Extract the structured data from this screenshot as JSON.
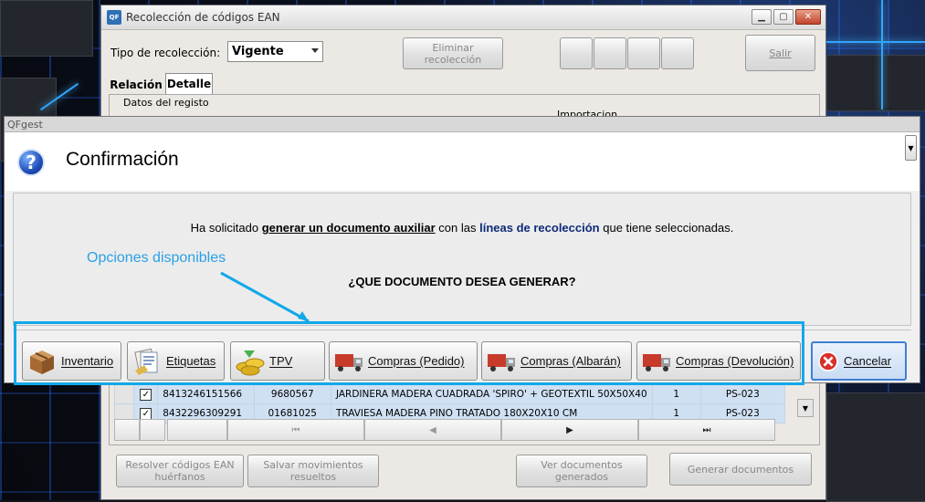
{
  "main_window": {
    "title": "Recolección de códigos EAN",
    "tipo_label": "Tipo de recolección:",
    "tipo_value": "Vigente",
    "eliminar_label": "Eliminar recolección",
    "salir_label": "Salir",
    "tabs": [
      {
        "label": "Relación"
      },
      {
        "label": "Detalle"
      }
    ],
    "datos_label": "Datos del registo",
    "importacion_label": "Importacion",
    "rows": [
      {
        "ean": "8413246151566",
        "ref": "9680567",
        "desc": "JARDINERA MADERA CUADRADA 'SPIRO' + GEOTEXTIL 50X50X40",
        "qty": "1",
        "code": "PS-023"
      },
      {
        "ean": "8432296309291",
        "ref": "01681025",
        "desc": "TRAVIESA MADERA PINO TRATADO 180X20X10 CM",
        "qty": "1",
        "code": "PS-023"
      }
    ],
    "resolver_label": "Resolver códigos EAN huérfanos",
    "salvar_label": "Salvar movimientos resueltos",
    "ver_label": "Ver documentos generados",
    "generar_label": "Generar documentos"
  },
  "dialog": {
    "window_title": "QFgest",
    "header": "Confirmación",
    "msg_part1": "Ha solicitado ",
    "msg_bold1": "generar un documento auxiliar",
    "msg_part2": " con las ",
    "msg_bold2": "líneas de recolección",
    "msg_part3": " que tiene seleccionadas.",
    "question": "¿QUE DOCUMENTO DESEA GENERAR?",
    "options_label": "Opciones disponibles",
    "buttons": [
      {
        "label": "Inventario",
        "icon": "box-icon"
      },
      {
        "label": "Etiquetas",
        "icon": "labels-icon"
      },
      {
        "label": "TPV",
        "icon": "coins-icon"
      },
      {
        "label": "Compras (Pedido)",
        "icon": "truck-icon"
      },
      {
        "label": "Compras (Albarán)",
        "icon": "truck-icon"
      },
      {
        "label": "Compras (Devolución)",
        "icon": "truck-icon"
      }
    ],
    "cancel_label": "Cancelar"
  },
  "colors": {
    "highlight": "#12a8ea",
    "cancel_icon": "#d8302a"
  }
}
